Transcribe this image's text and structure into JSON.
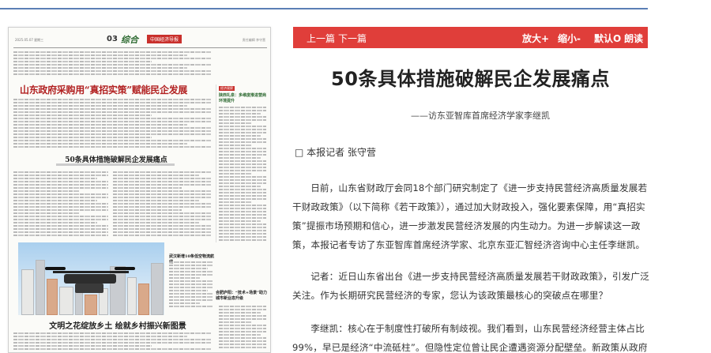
{
  "paper": {
    "date": "2025.05.07 星期三",
    "page_number": "03",
    "section": "综合",
    "masthead": "中国经济导报",
    "meta": "责任编辑 李守营",
    "headline": "山东政府采购用“真招实策”赋能民企发展",
    "subhead": "50条具体措施破解民企发展痛点",
    "sidebar_tag": "经济观察",
    "sidebar_title": "陕西礼泉：多维度推进营商环境提升",
    "photo_caption_title": "武汉新增10条低空物流航线",
    "photo_right_title": "合肥庐阳：“技术+场景”助力城市新业态升级",
    "bottom_headline": "文明之花绽放乡土 绘就乡村振兴新图景"
  },
  "toolbar": {
    "prev": "上一篇",
    "next": "下一篇",
    "zoom_in": "放大+",
    "zoom_out": "缩小-",
    "default": "默认O",
    "read_aloud": "朗读"
  },
  "article": {
    "title": "50条具体措施破解民企发展痛点",
    "subtitle": "——访东亚智库首席经济学家李继凯",
    "byline": "□ 本报记者 张守营",
    "paragraphs": [
      "日前，山东省财政厅会同18个部门研究制定了《进一步支持民营经济高质量发展若干财政政策》（以下简称《若干政策》），通过加大财政投入，强化要素保障，用“真招实策”提振市场预期和信心，进一步激发民营经济发展的内生动力。为进一步解读这一政策，本报记者专访了东亚智库首席经济学家、北京东亚汇智经济咨询中心主任李继凯。",
      "记者：近日山东省出台《进一步支持民营经济高质量发展若干财政政策》，引发广泛关注。作为长期研究民营经济的专家，您认为该政策最核心的突破点在哪里？",
      "李继凯：核心在于制度性打破所有制歧视。我们看到，山东民营经济经营主体占比99%，早已是经济“中流砥柱”。但隐性定位曾让民企遭遇资源分配壁垒。新政策从政府"
    ]
  },
  "colors": {
    "toolbar": "#e03e3a",
    "top_rule": "#5b7fb5",
    "paper_headline": "#b22222",
    "section": "#2d6a31"
  }
}
